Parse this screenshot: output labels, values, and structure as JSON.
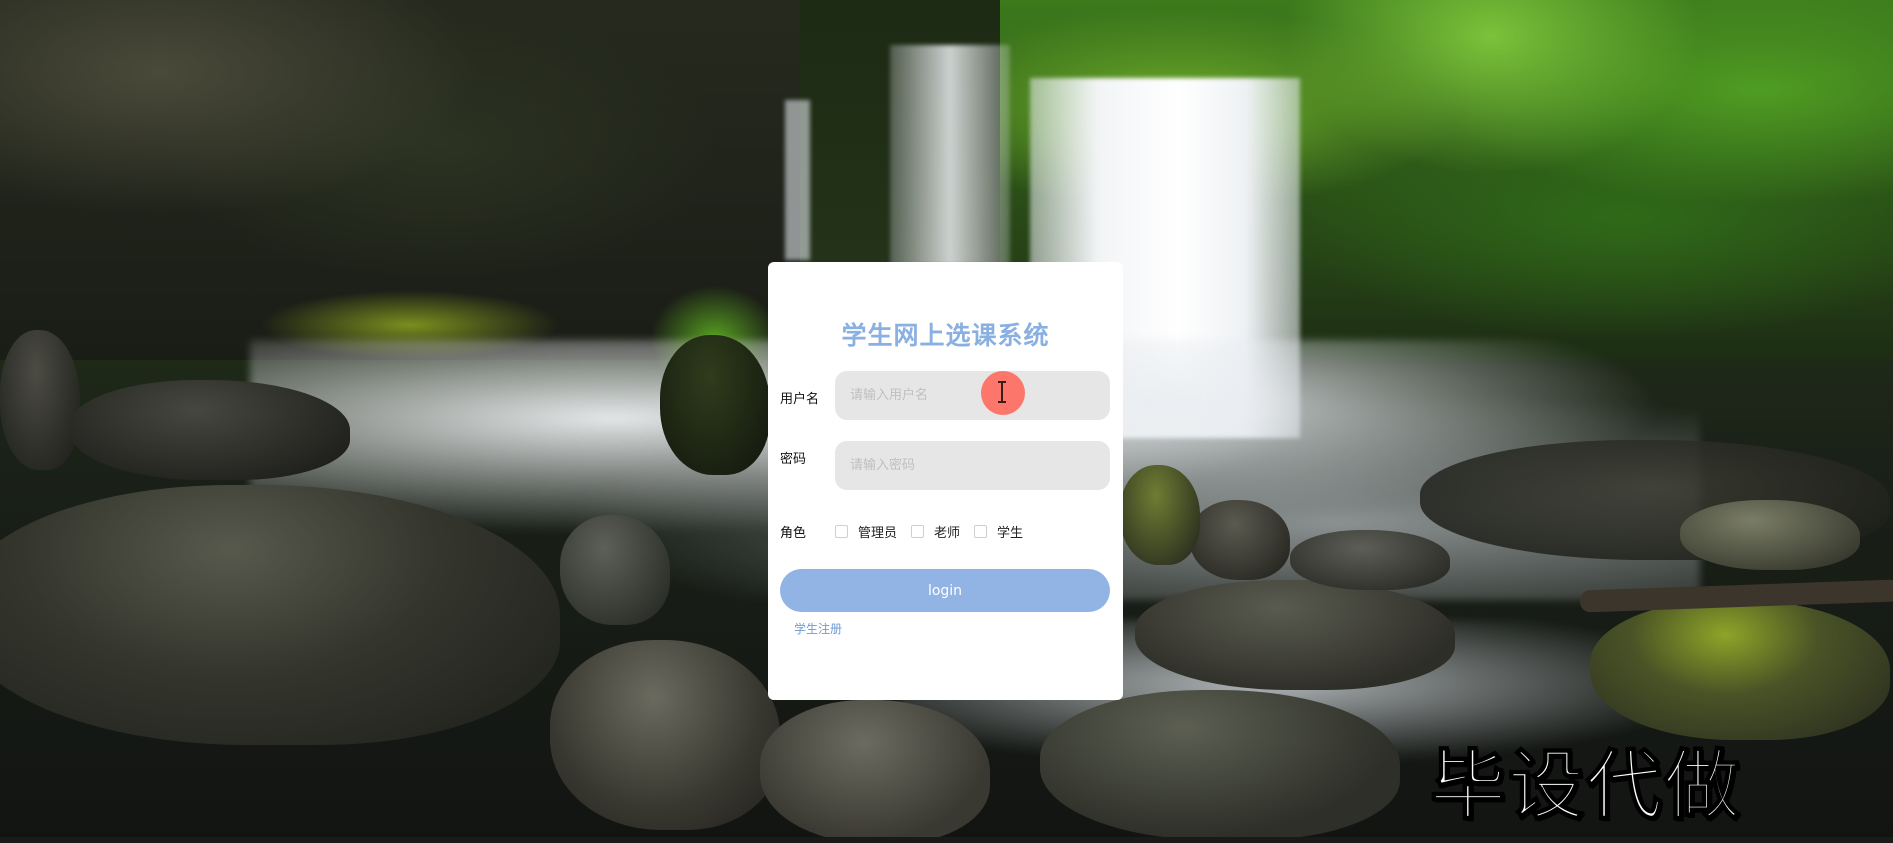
{
  "login_form": {
    "title": "学生网上选课系统",
    "username_label": "用户名",
    "username_placeholder": "请输入用户名",
    "password_label": "密码",
    "password_placeholder": "请输入密码",
    "role_label": "角色",
    "roles": [
      {
        "label": "管理员",
        "checked": false
      },
      {
        "label": "老师",
        "checked": false
      },
      {
        "label": "学生",
        "checked": false
      }
    ],
    "login_button": "login",
    "register_link": "学生注册"
  },
  "watermark": "毕设代做",
  "colors": {
    "title": "#8ab0e2",
    "button": "#91b4e4",
    "link": "#6f9ad8",
    "input_bg": "#e6e6e6",
    "cursor_highlight": "#ff665a"
  }
}
